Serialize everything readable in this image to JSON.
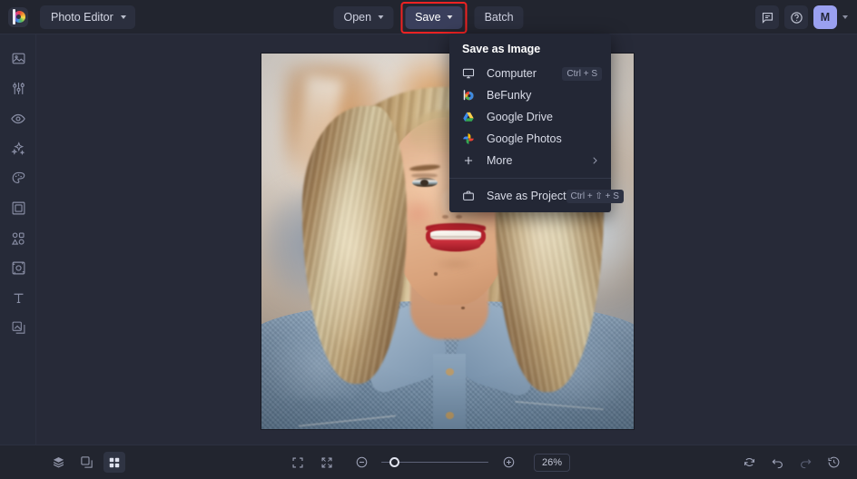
{
  "app": {
    "name": "BeFunky Photo Editor",
    "logo_icon": "befunky-logo-icon"
  },
  "header": {
    "workspace_label": "Photo Editor",
    "workspace_caret_icon": "chevron-down-icon",
    "buttons": [
      {
        "label": "Open",
        "has_caret": true,
        "name": "open-button"
      },
      {
        "label": "Save",
        "has_caret": true,
        "name": "save-button",
        "highlighted": true
      },
      {
        "label": "Batch",
        "has_caret": false,
        "name": "batch-button"
      }
    ],
    "right_icons": [
      {
        "name": "feedback-icon",
        "title": "Feedback"
      },
      {
        "name": "help-icon",
        "title": "Help"
      }
    ],
    "avatar_initial": "M",
    "avatar_caret_icon": "chevron-down-icon",
    "accent_color": "#9aa0f0",
    "highlight_color": "#ef2222"
  },
  "sidebar": {
    "items": [
      {
        "name": "sidebar-item-edit",
        "icon": "image-edit-icon",
        "label": "Edit"
      },
      {
        "name": "sidebar-item-adjust",
        "icon": "sliders-icon",
        "label": "Adjust"
      },
      {
        "name": "sidebar-item-retouch",
        "icon": "eye-icon",
        "label": "Touch Up"
      },
      {
        "name": "sidebar-item-effects",
        "icon": "sparkles-icon",
        "label": "Effects"
      },
      {
        "name": "sidebar-item-artsy",
        "icon": "palette-icon",
        "label": "Artsy"
      },
      {
        "name": "sidebar-item-frames",
        "icon": "frame-icon",
        "label": "Frames"
      },
      {
        "name": "sidebar-item-graphics",
        "icon": "shapes-icon",
        "label": "Graphics"
      },
      {
        "name": "sidebar-item-textures",
        "icon": "texture-icon",
        "label": "Textures"
      },
      {
        "name": "sidebar-item-text",
        "icon": "text-t-icon",
        "label": "Text"
      },
      {
        "name": "sidebar-item-overlays",
        "icon": "overlays-icon",
        "label": "Overlays"
      }
    ]
  },
  "save_menu": {
    "title": "Save as Image",
    "items": [
      {
        "name": "menu-item-computer",
        "icon": "monitor-icon",
        "label": "Computer",
        "shortcut": "Ctrl + S"
      },
      {
        "name": "menu-item-befunky",
        "icon": "befunky-icon",
        "label": "BeFunky",
        "shortcut": ""
      },
      {
        "name": "menu-item-google-drive",
        "icon": "google-drive-icon",
        "label": "Google Drive",
        "shortcut": ""
      },
      {
        "name": "menu-item-google-photos",
        "icon": "google-photos-icon",
        "label": "Google Photos",
        "shortcut": ""
      },
      {
        "name": "menu-item-more",
        "icon": "plus-icon",
        "label": "More",
        "shortcut": "",
        "submenu_icon": "chevron-right-icon"
      }
    ],
    "project_item": {
      "name": "menu-item-save-as-project",
      "icon": "briefcase-icon",
      "label": "Save as Project",
      "shortcut": "Ctrl + ⇧ + S"
    }
  },
  "canvas": {
    "image_alt": "Portrait photo of a smiling blonde woman wearing a denim jacket"
  },
  "bottombar": {
    "left_tools": [
      {
        "name": "layers-button",
        "icon": "layers-icon",
        "active": false
      },
      {
        "name": "compare-button",
        "icon": "compare-icon",
        "active": false
      },
      {
        "name": "grid-button",
        "icon": "grid-icon",
        "active": true
      }
    ],
    "view_tools": [
      {
        "name": "fullscreen-button",
        "icon": "fullscreen-icon"
      },
      {
        "name": "fit-to-screen-button",
        "icon": "fit-screen-icon"
      }
    ],
    "zoom_out": {
      "name": "zoom-out-button",
      "icon": "minus-circle-icon"
    },
    "zoom_in": {
      "name": "zoom-in-button",
      "icon": "plus-circle-icon"
    },
    "zoom_level": "26%",
    "zoom_slider_percent": 12,
    "right_tools": [
      {
        "name": "reset-button",
        "icon": "reset-icon",
        "disabled": false
      },
      {
        "name": "undo-button",
        "icon": "undo-icon",
        "disabled": false
      },
      {
        "name": "redo-button",
        "icon": "redo-icon",
        "disabled": true
      },
      {
        "name": "history-button",
        "icon": "history-icon",
        "disabled": false
      }
    ]
  }
}
